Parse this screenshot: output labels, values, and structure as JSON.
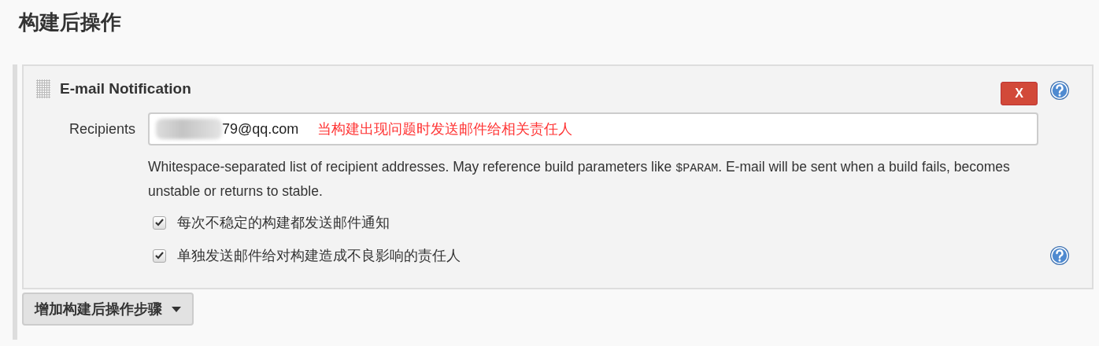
{
  "section_title": "构建后操作",
  "publisher": {
    "title": "E-mail Notification",
    "delete_label": "X",
    "recipients": {
      "label": "Recipients",
      "value": "79@qq.com",
      "redacted": true,
      "annotation": "当构建出现问题时发送邮件给相关责任人"
    },
    "description": {
      "before": "Whitespace-separated list of recipient addresses. May reference build parameters like ",
      "code": "$PARAM",
      "after": ". E-mail will be sent when a build fails, becomes unstable or returns to stable."
    },
    "options": [
      {
        "label": "每次不稳定的构建都发送邮件通知",
        "checked": true,
        "help": false
      },
      {
        "label": "单独发送邮件给对构建造成不良影响的责任人",
        "checked": true,
        "help": true
      }
    ]
  },
  "add_button": {
    "label": "增加构建后操作步骤"
  }
}
